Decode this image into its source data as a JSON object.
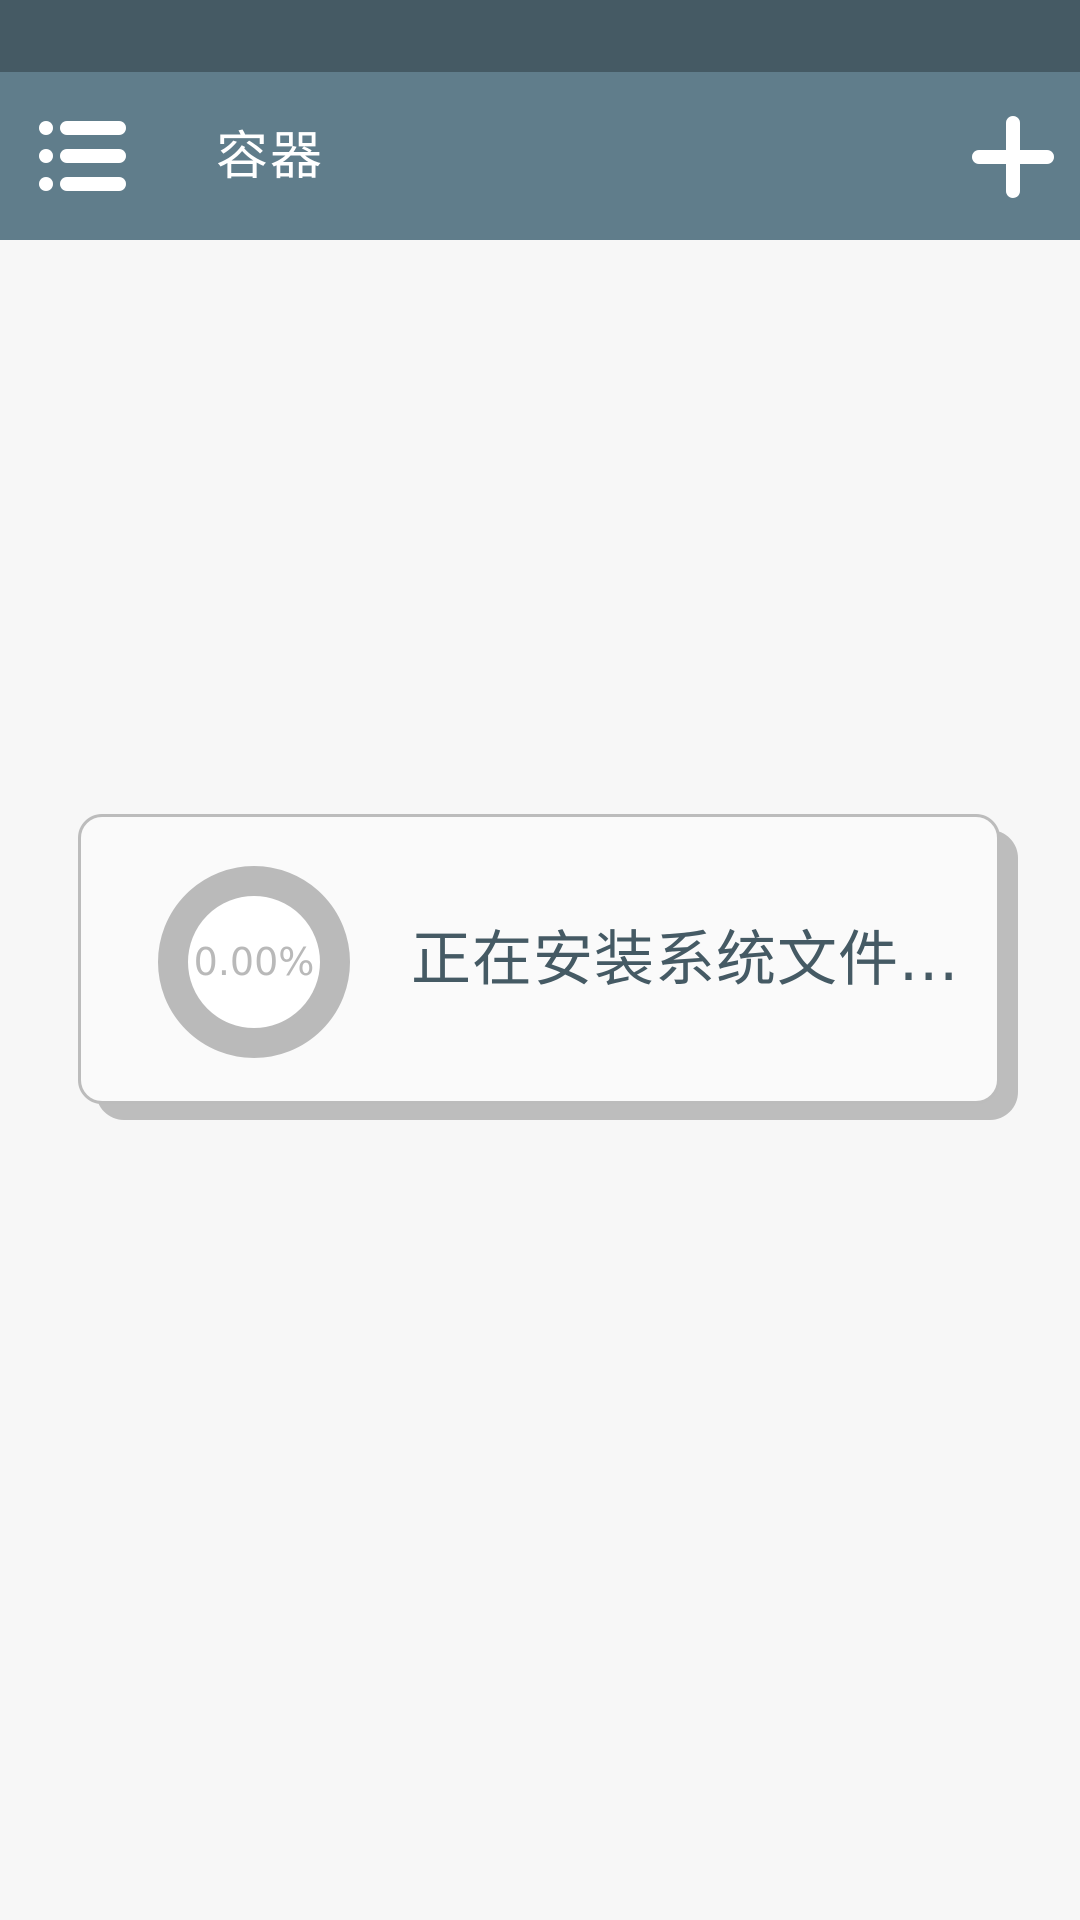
{
  "app_bar": {
    "title": "容器",
    "menu_icon": "menu-icon",
    "add_icon": "plus-icon",
    "color": "#607d8b",
    "status_bar_color": "#455a64"
  },
  "progress_dialog": {
    "progress_text": "0.00%",
    "progress_fraction": 0,
    "message": "正在安装系统文件...",
    "text_color": "#455a64",
    "ring_color": "#bababa"
  }
}
